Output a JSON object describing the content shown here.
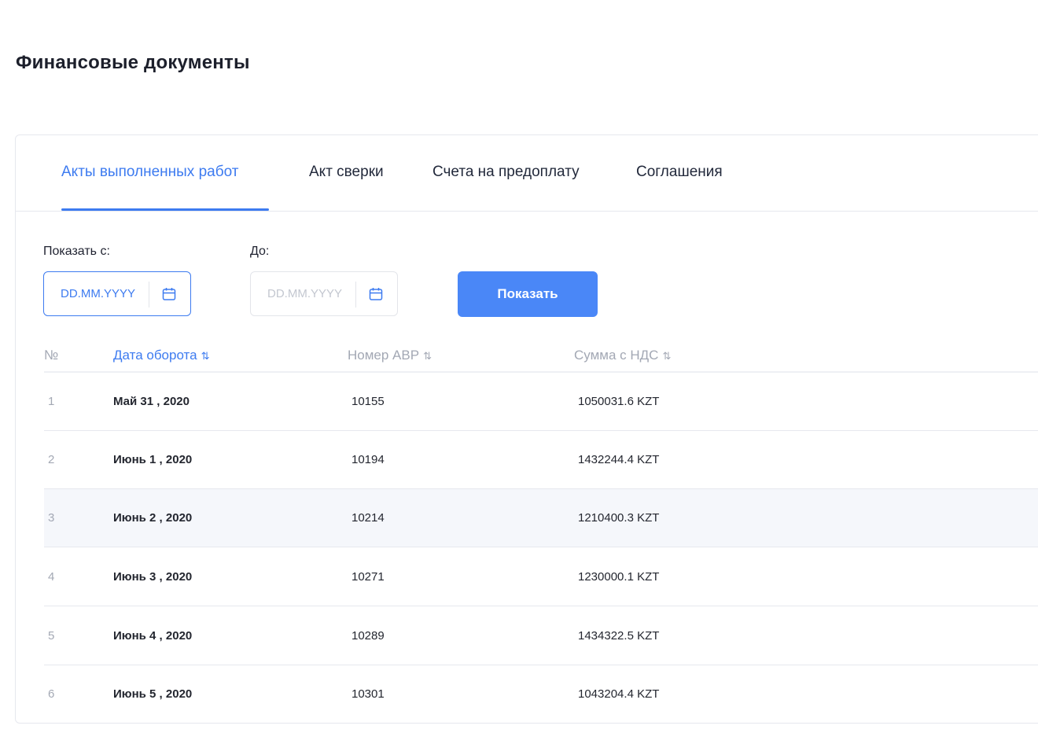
{
  "page": {
    "title": "Финансовые документы"
  },
  "tabs": [
    {
      "label": "Акты выполненных работ",
      "active": true
    },
    {
      "label": "Акт сверки",
      "active": false
    },
    {
      "label": "Счета на предоплату",
      "active": false
    },
    {
      "label": "Соглашения",
      "active": false
    }
  ],
  "filters": {
    "from_label": "Показать с:",
    "to_label": "До:",
    "from_placeholder": "DD.MM.YYYY",
    "to_placeholder": "DD.MM.YYYY",
    "show_button": "Показать"
  },
  "table": {
    "columns": {
      "num": "№",
      "date": "Дата оборота",
      "avr": "Номер АВР",
      "sum": "Сумма с НДС"
    },
    "sort_icon": "⇅",
    "rows": [
      {
        "num": "1",
        "date": "Май 31 , 2020",
        "avr": "10155",
        "sum": "1050031.6 KZT"
      },
      {
        "num": "2",
        "date": "Июнь 1 , 2020",
        "avr": "10194",
        "sum": "1432244.4 KZT"
      },
      {
        "num": "3",
        "date": "Июнь 2 , 2020",
        "avr": "10214",
        "sum": "1210400.3 KZT"
      },
      {
        "num": "4",
        "date": "Июнь 3 , 2020",
        "avr": "10271",
        "sum": "1230000.1 KZT"
      },
      {
        "num": "5",
        "date": "Июнь 4 , 2020",
        "avr": "10289",
        "sum": "1434322.5 KZT"
      },
      {
        "num": "6",
        "date": "Июнь 5 , 2020",
        "avr": "10301",
        "sum": "1043204.4 KZT"
      }
    ]
  },
  "colors": {
    "accent": "#3d7bf0",
    "button": "#4a87f7",
    "highlight_row": "#f5f7fb"
  }
}
